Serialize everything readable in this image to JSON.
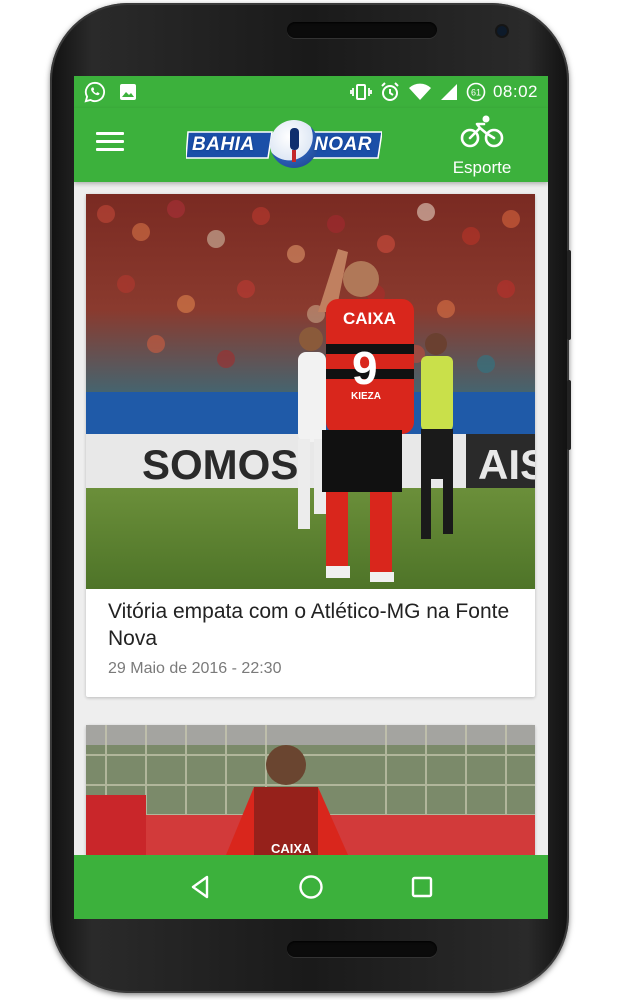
{
  "status_bar": {
    "time": "08:02",
    "battery_level": "61",
    "left_icons": [
      "whatsapp-icon",
      "image-icon"
    ],
    "right_icons": [
      "vibrate-icon",
      "alarm-icon",
      "wifi-icon",
      "signal-icon",
      "battery-icon"
    ]
  },
  "app_bar": {
    "logo_left": "BAHIA",
    "logo_right": "NOAR",
    "section_label": "Esporte",
    "menu_icon": "hamburger-menu-icon",
    "section_icon": "bicycle-icon"
  },
  "feed": {
    "articles": [
      {
        "title": "Vitória empata com o Atlético-MG na Fonte Nova",
        "date": "29 Maio de 2016 - 22:30",
        "image": {
          "banner_text_left": "SOMOS",
          "banner_text_right": "AIS",
          "jersey_sponsor": "CAIXA",
          "jersey_number": "9",
          "jersey_name": "KIEZA"
        }
      },
      {
        "title": "",
        "date": "",
        "image": {
          "jersey_text": "CAIXA"
        }
      }
    ]
  },
  "nav_bar": {
    "back_icon": "back-triangle-icon",
    "home_icon": "home-circle-icon",
    "recents_icon": "recents-square-icon"
  },
  "colors": {
    "primary_green": "#3cb13c",
    "background": "#eeeeee",
    "title_text": "#222222",
    "date_text": "#7a7a7a",
    "jersey_red": "#d9261c"
  }
}
